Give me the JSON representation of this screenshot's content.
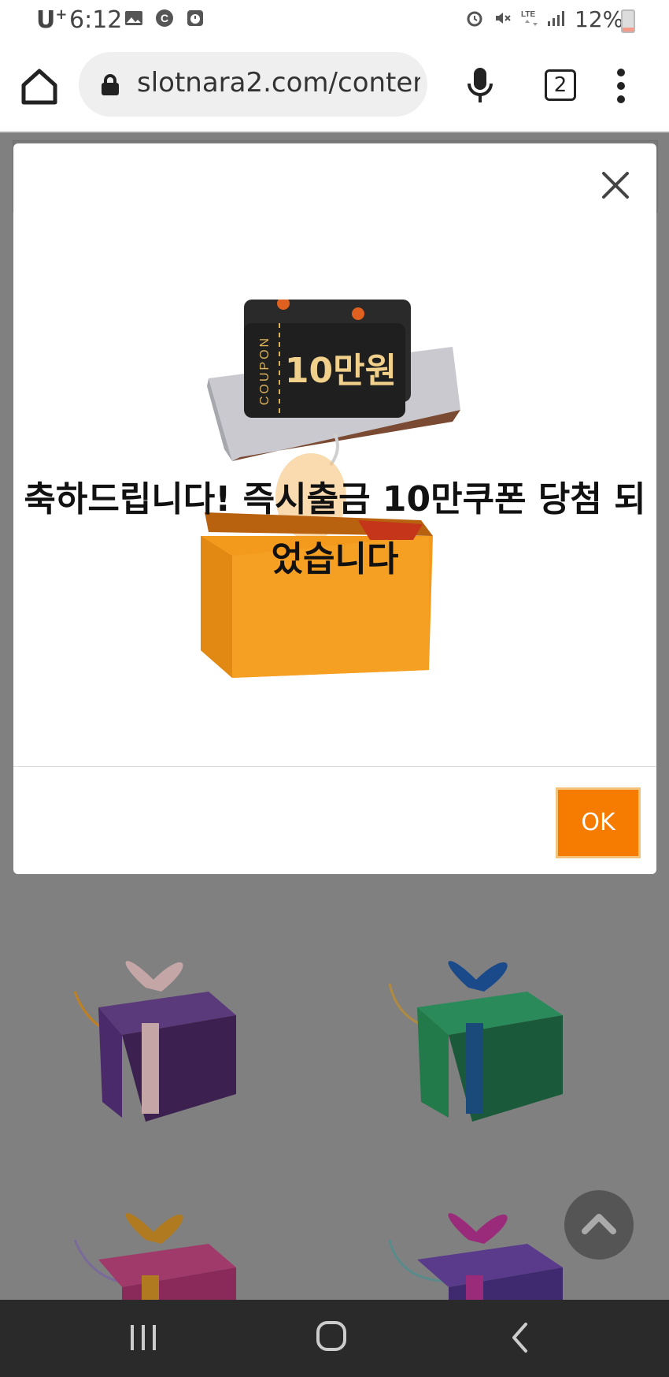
{
  "status_bar": {
    "carrier": "U",
    "carrier_sup": "+",
    "time": "6:12",
    "network": "LTE",
    "battery_percent": "12%"
  },
  "browser": {
    "url": "slotnara2.com/conten",
    "tab_count": "2"
  },
  "modal": {
    "message": "축하드립니다! 즉시출금 10만쿠폰 당첨 되었습니다",
    "coupon_label": "COUPON",
    "coupon_amount": "10만원",
    "ok_label": "OK"
  },
  "colors": {
    "accent": "#f57c00",
    "backdrop": "#808080"
  }
}
